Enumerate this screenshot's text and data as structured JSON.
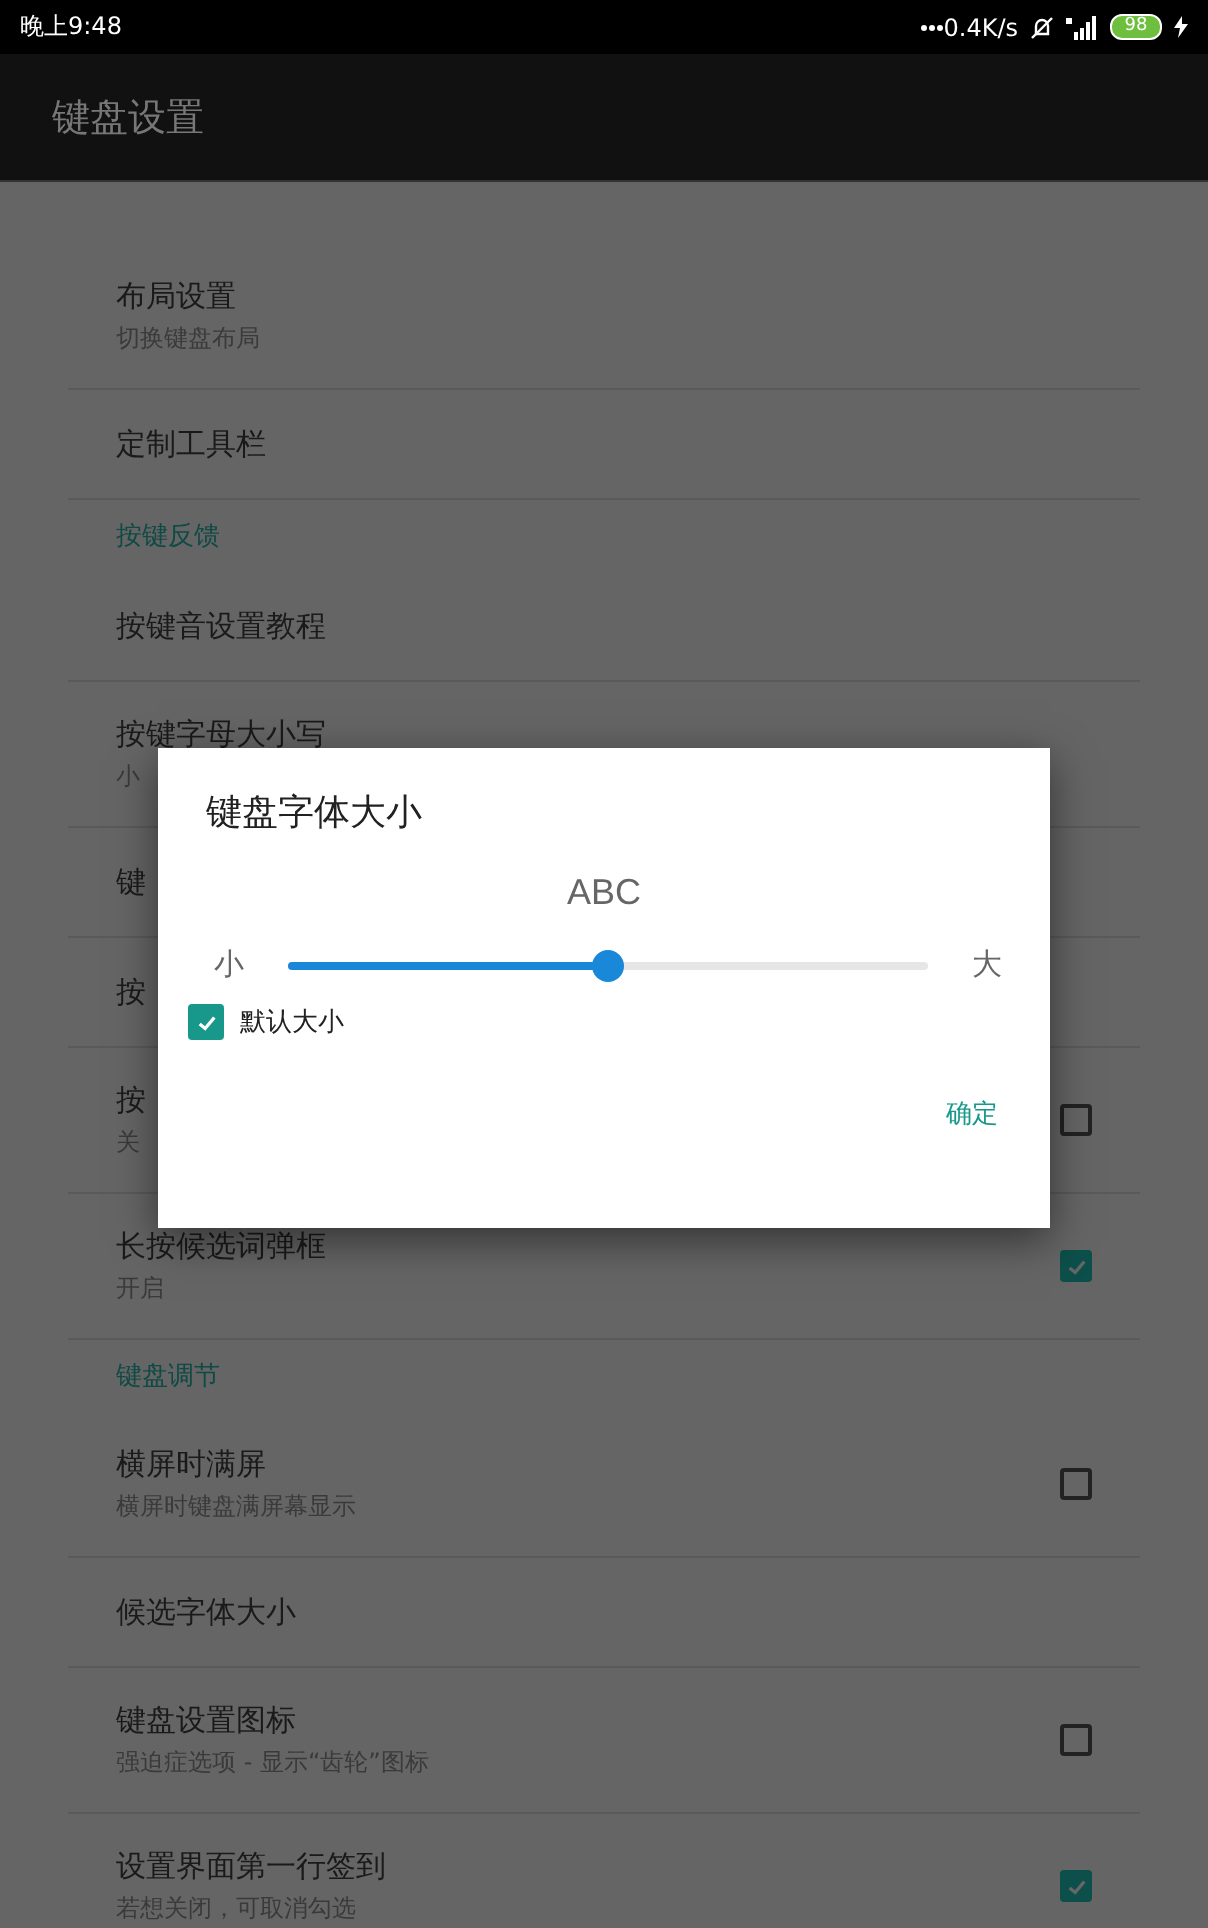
{
  "status_bar": {
    "time": "晚上9:48",
    "speed": "0.4K/s",
    "battery": "98"
  },
  "app_bar": {
    "title": "键盘设置"
  },
  "settings": [
    {
      "kind": "item",
      "title": "布局设置",
      "subtitle": "切换键盘布局"
    },
    {
      "kind": "item",
      "title": "定制工具栏"
    },
    {
      "kind": "header",
      "title": "按键反馈"
    },
    {
      "kind": "item",
      "title": "按键音设置教程"
    },
    {
      "kind": "item",
      "title": "按键字母大小写",
      "subtitle": "小"
    },
    {
      "kind": "item",
      "title": "键"
    },
    {
      "kind": "item",
      "title": "按"
    },
    {
      "kind": "checkbox",
      "title": "按",
      "subtitle": "关",
      "checked": false
    },
    {
      "kind": "checkbox",
      "title": "长按候选词弹框",
      "subtitle": "开启",
      "checked": true
    },
    {
      "kind": "header",
      "title": "键盘调节"
    },
    {
      "kind": "checkbox",
      "title": "横屏时满屏",
      "subtitle": "横屏时键盘满屏幕显示",
      "checked": false
    },
    {
      "kind": "item",
      "title": "候选字体大小"
    },
    {
      "kind": "checkbox",
      "title": "键盘设置图标",
      "subtitle": "强迫症选项 - 显示“齿轮”图标",
      "checked": false
    },
    {
      "kind": "checkbox",
      "title": "设置界面第一行签到",
      "subtitle": "若想关闭，可取消勾选",
      "checked": true
    }
  ],
  "dialog": {
    "title": "键盘字体大小",
    "preview": "ABC",
    "min_label": "小",
    "max_label": "大",
    "level": 0.5,
    "checkbox": {
      "label": "默认大小",
      "checked": true
    },
    "ok_button": "确定"
  }
}
